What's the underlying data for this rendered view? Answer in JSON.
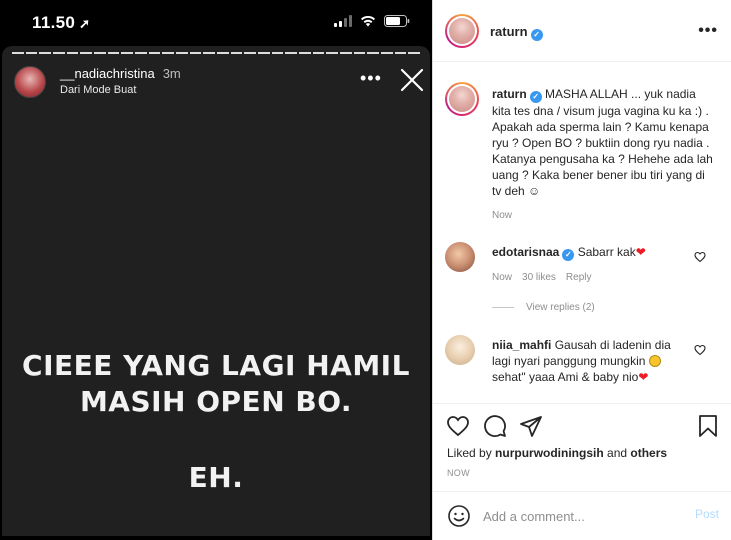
{
  "status_bar": {
    "time": "11.50",
    "location_icon": "location-arrow-icon",
    "signal_icon": "cellular-signal-icon",
    "wifi_icon": "wifi-icon",
    "battery_icon": "battery-icon"
  },
  "story": {
    "username": "__nadiachristina",
    "time": "3m",
    "subtitle": "Dari Mode Buat",
    "text_line1": "CIEEE YANG LAGI HAMIL",
    "text_line2": "MASIH OPEN BO.",
    "text_line3": "EH.",
    "background_color": "#202020"
  },
  "post": {
    "username": "raturn",
    "caption_username": "raturn",
    "caption_text": " MASHA ALLAH ... yuk nadia kita tes dna / visum juga vagina ku ka :) . Apakah ada sperma lain ? Kamu kenapa ryu ? Open BO ? buktiin dong ryu nadia . Katanya pengusaha ka ? Hehehe ada lah uang ? Kaka bener bener ibu tiri yang di tv deh ",
    "caption_emoji": "☺",
    "caption_time": "Now",
    "comments": [
      {
        "username": "edotarisnaa",
        "text": " Sabarr kak",
        "emoji": "❤",
        "time": "Now",
        "likes": "30 likes",
        "reply_label": "Reply",
        "view_replies": "View replies (2)"
      },
      {
        "username": "niia_mahfi",
        "text_part1": " Gausah di ladenin dia lagi nyari panggung mungkin ",
        "text_part2": " sehat\" yaaa Ami & baby nio"
      }
    ],
    "liked_by_prefix": "Liked by ",
    "liked_by_user": "nurpurwodiningsih",
    "liked_by_and": " and ",
    "liked_by_others": "others",
    "time": "NOW",
    "comment_placeholder": "Add a comment...",
    "post_label": "Post",
    "accent_color": "#3897f0"
  }
}
